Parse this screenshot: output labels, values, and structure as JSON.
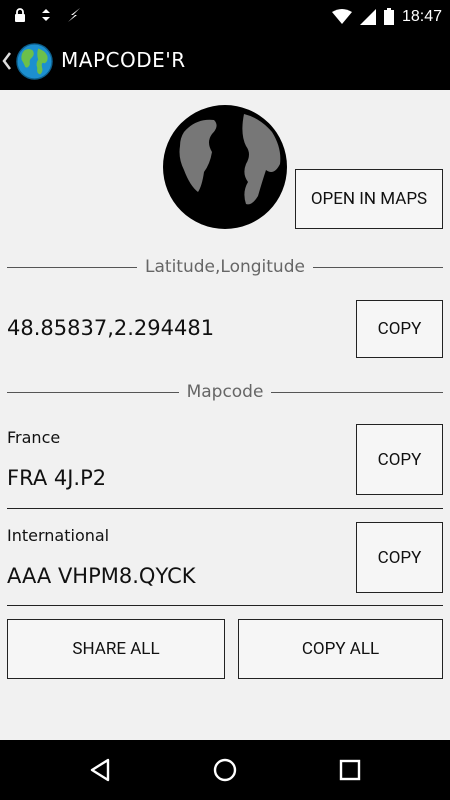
{
  "status_bar": {
    "time": "18:47",
    "icons": [
      "lock-icon",
      "sync-icon",
      "flash-icon",
      "wifi-icon",
      "signal-icon",
      "battery-icon"
    ]
  },
  "app_bar": {
    "title": "MAPCODE'R",
    "icons": [
      "back-chevron-icon",
      "globe-logo-icon"
    ]
  },
  "main": {
    "open_in_maps_label": "OPEN IN MAPS",
    "latlon_section_label": "Latitude,Longitude",
    "latlon_value": "48.85837,2.294481",
    "latlon_copy_label": "COPY",
    "mapcode_section_label": "Mapcode",
    "local": {
      "label": "France",
      "value": "FRA 4J.P2",
      "copy_label": "COPY"
    },
    "international": {
      "label": "International",
      "value": "AAA VHPM8.QYCK",
      "copy_label": "COPY"
    },
    "share_all_label": "SHARE ALL",
    "copy_all_label": "COPY ALL"
  },
  "nav_bar": {
    "icons": [
      "back-triangle-icon",
      "home-circle-icon",
      "recents-square-icon"
    ]
  },
  "colors": {
    "bar_background": "#000000",
    "content_background": "#f1f1f1",
    "globe_dark": "#000000",
    "globe_land": "#777777",
    "logo_ocean": "#1c8fd0",
    "logo_land": "#6cc04a"
  }
}
